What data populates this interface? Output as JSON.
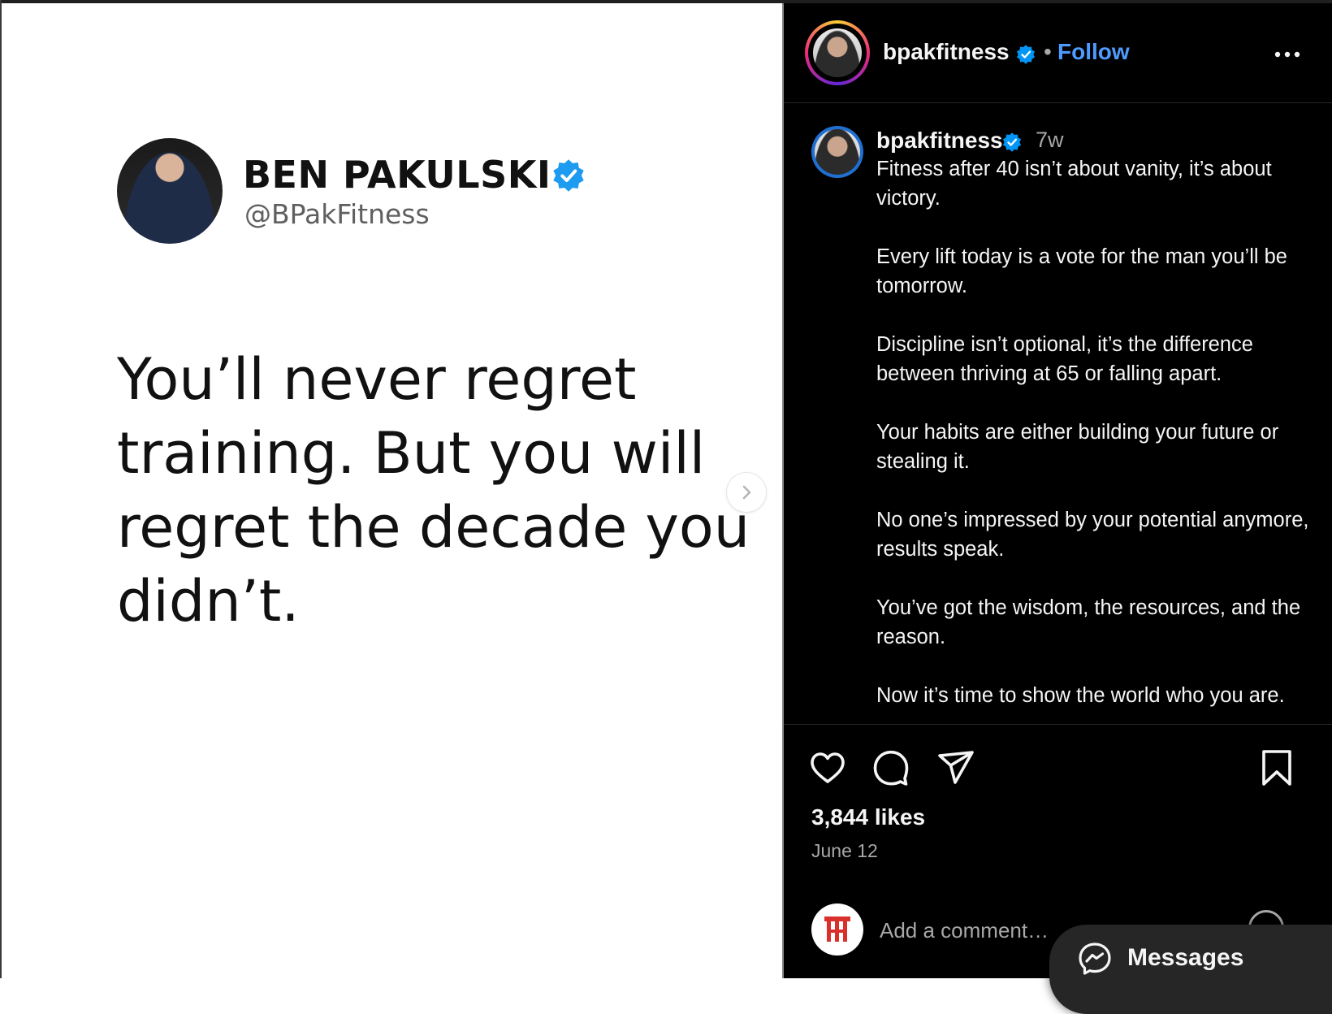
{
  "post_image": {
    "name": "BEN PAKULSKI",
    "handle": "@BPakFitness",
    "quote": "You’ll never regret training. But you will regret the decade you didn’t."
  },
  "header": {
    "username": "bpakfitness",
    "separator": "•",
    "follow_label": "Follow",
    "more_icon": "more-horizontal-icon"
  },
  "caption": {
    "username": "bpakfitness",
    "time_ago": "7w",
    "paragraphs": [
      "Fitness after 40 isn’t about vanity, it’s about victory.",
      "Every lift today is a vote for the man you’ll be tomorrow.",
      "Discipline isn’t optional, it’s the difference between thriving at 65 or falling apart.",
      "Your habits are either building your future or stealing it.",
      "No one’s impressed by your potential anymore, results speak.",
      "You’ve got the wisdom, the resources, and the reason.",
      "Now it’s time to show the world who you are."
    ]
  },
  "actions": {
    "like_icon": "heart-icon",
    "comment_icon": "comment-icon",
    "share_icon": "send-icon",
    "save_icon": "bookmark-icon"
  },
  "likes": "3,844 likes",
  "date": "June 12",
  "comment": {
    "placeholder": "Add a comment…",
    "emoji_icon": "emoji-icon"
  },
  "messages": {
    "label": "Messages",
    "icon": "messenger-icon"
  },
  "colors": {
    "verified": "#0095f6",
    "follow": "#4e9bff",
    "panel_bg": "#000000",
    "muted": "#a8a8a8"
  }
}
